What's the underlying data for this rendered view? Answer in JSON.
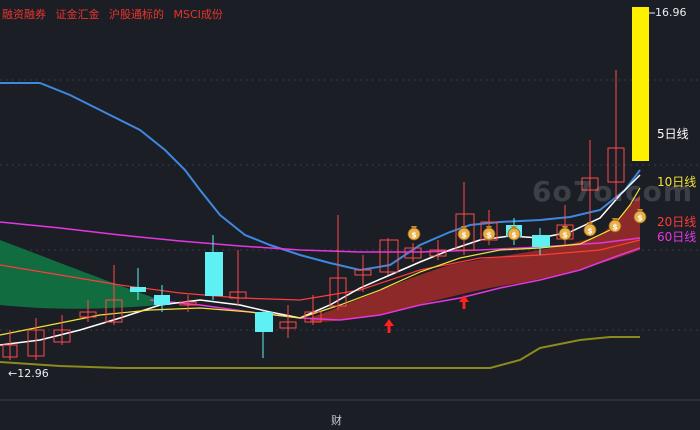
{
  "header": {
    "tags": [
      "融资融券",
      "证金汇金",
      "沪股通标的",
      "MSCI成份"
    ]
  },
  "price_labels": {
    "high": "16.96",
    "low": "←12.96"
  },
  "ma_labels": [
    {
      "label": "5日线",
      "color": "#ffffff"
    },
    {
      "label": "10日线",
      "color": "#f3e23a"
    },
    {
      "label": "20日线",
      "color": "#ff3b3b"
    },
    {
      "label": "60日线",
      "color": "#e437e0"
    }
  ],
  "footer": {
    "label": "财"
  },
  "watermark": "6o7o.com",
  "colors": {
    "background": "#1b1e25",
    "up_candle": "#ff4a4a",
    "down_candle": "#5ff0f4",
    "highlight_bar": "#fff000",
    "band_red": "#9b2a2a",
    "band_green": "#0f7a45",
    "blue_line": "#3f88e0",
    "olive_line": "#8b8a1c",
    "arrow": "#ff2020"
  },
  "icons": {
    "signal": "money-bag-icon",
    "buy": "red-up-arrow-icon"
  },
  "chart_data": {
    "type": "candlestick",
    "y_high": 16.96,
    "y_low": 12.96
  }
}
